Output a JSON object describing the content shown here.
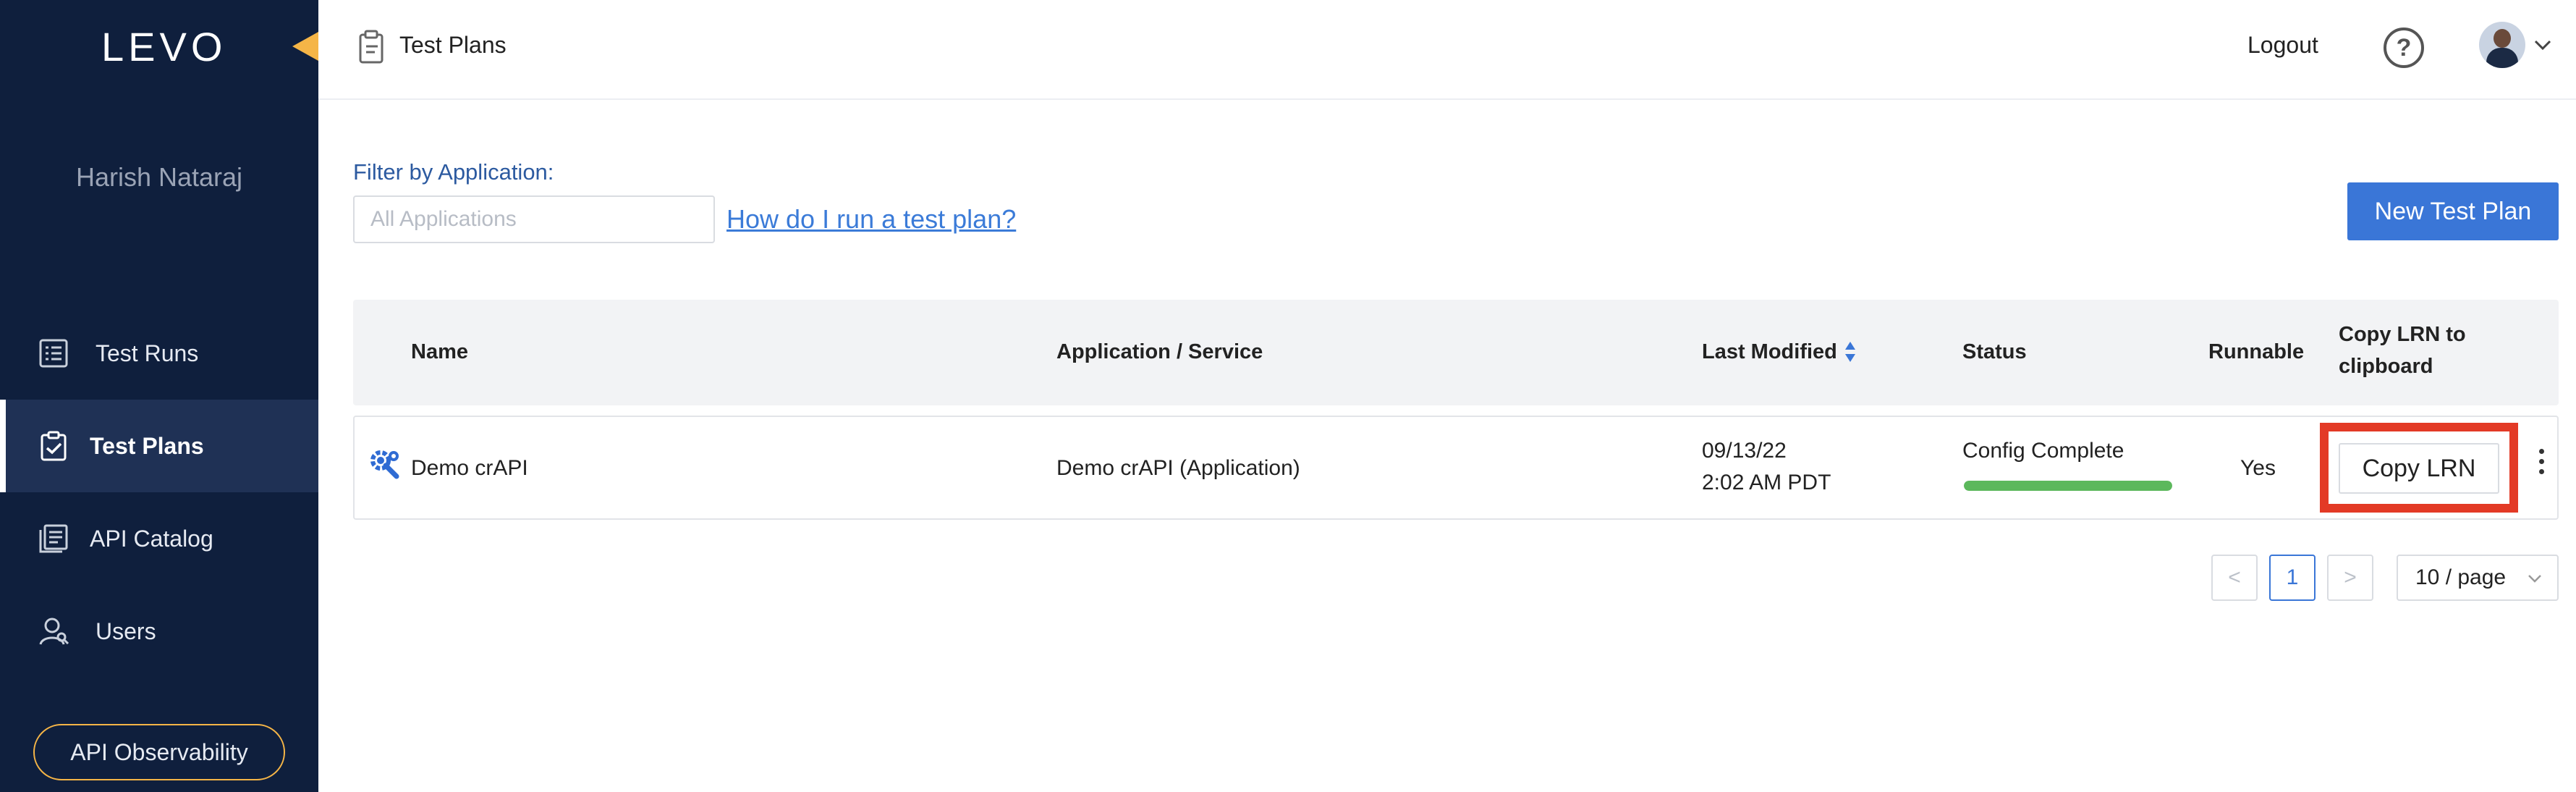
{
  "sidebar": {
    "logo": "LEVO",
    "user_name": "Harish Nataraj",
    "items": [
      {
        "label": "Test Runs",
        "icon": "list-icon",
        "active": false
      },
      {
        "label": "Test Plans",
        "icon": "clipboard-check-icon",
        "active": true
      },
      {
        "label": "API Catalog",
        "icon": "catalog-icon",
        "active": false
      },
      {
        "label": "Users",
        "icon": "users-icon",
        "active": false
      }
    ],
    "observability_button": "API Observability"
  },
  "header": {
    "title": "Test Plans",
    "logout": "Logout",
    "help": "?"
  },
  "filter": {
    "label": "Filter by Application:",
    "placeholder": "All Applications",
    "help_link": "How do I run a test plan?"
  },
  "new_plan_button": "New Test Plan",
  "table": {
    "columns": {
      "name": "Name",
      "application": "Application / Service",
      "last_modified": "Last Modified",
      "status": "Status",
      "runnable": "Runnable",
      "copy_lrn_line1": "Copy LRN to",
      "copy_lrn_line2": "clipboard"
    },
    "rows": [
      {
        "name": "Demo crAPI",
        "application": "Demo crAPI (Application)",
        "date": "09/13/22",
        "time": "2:02 AM PDT",
        "status": "Config Complete",
        "status_progress": 1.0,
        "runnable": "Yes",
        "copy_button": "Copy LRN"
      }
    ]
  },
  "pagination": {
    "prev": "<",
    "current": "1",
    "next": ">",
    "page_size": "10 / page"
  },
  "colors": {
    "sidebar_bg": "#0f1f3d",
    "accent": "#f5b547",
    "primary": "#3a76d7",
    "status_green": "#5cb85c",
    "highlight_red": "#e33a26"
  }
}
